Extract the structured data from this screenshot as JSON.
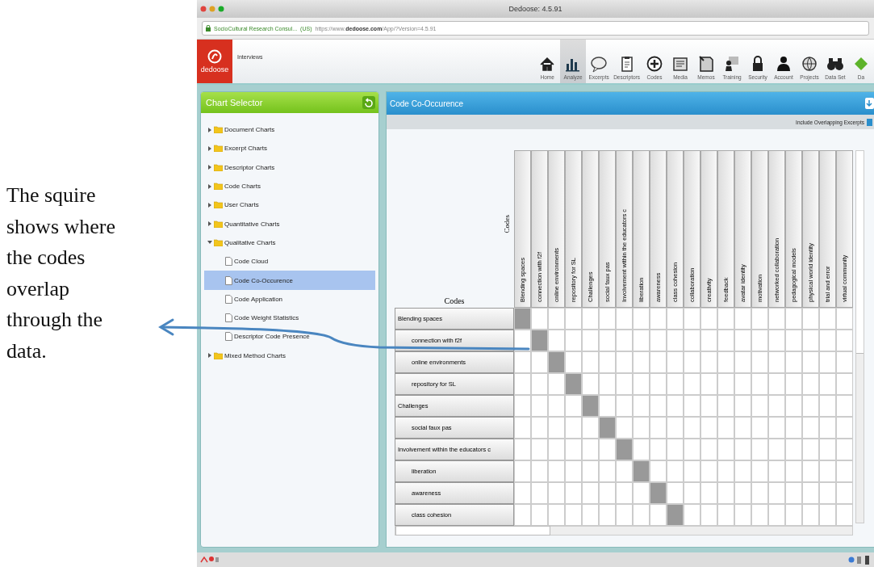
{
  "annotation": {
    "text": "The squire shows where the codes overlap through the data."
  },
  "window": {
    "title": "Dedoose: 4.5.91"
  },
  "address_bar": {
    "site": "SocioCultural Research Consul...",
    "country": "(US)",
    "url_start": "https://www.",
    "url_domain": "dedoose.com",
    "url_end": "/App/?Version=4.5.91"
  },
  "app_header": {
    "logo": "dedoose",
    "project": "Interviews"
  },
  "toolbar": [
    {
      "label": "Home",
      "selected": false
    },
    {
      "label": "Analyze",
      "selected": true
    },
    {
      "label": "Excerpts",
      "selected": false
    },
    {
      "label": "Descriptors",
      "selected": false
    },
    {
      "label": "Codes",
      "selected": false
    },
    {
      "label": "Media",
      "selected": false
    },
    {
      "label": "Memos",
      "selected": false
    },
    {
      "label": "Training",
      "selected": false
    },
    {
      "label": "Security",
      "selected": false
    },
    {
      "label": "Account",
      "selected": false
    },
    {
      "label": "Projects",
      "selected": false
    },
    {
      "label": "Data Set",
      "selected": false
    },
    {
      "label": "Da",
      "selected": false
    }
  ],
  "chart_selector": {
    "title": "Chart Selector",
    "tree": [
      {
        "label": "Document Charts",
        "kind": "folder",
        "expanded": false,
        "selected": false
      },
      {
        "label": "Excerpt Charts",
        "kind": "folder",
        "expanded": false,
        "selected": false
      },
      {
        "label": "Descriptor Charts",
        "kind": "folder",
        "expanded": false,
        "selected": false
      },
      {
        "label": "Code Charts",
        "kind": "folder",
        "expanded": false,
        "selected": false
      },
      {
        "label": "User Charts",
        "kind": "folder",
        "expanded": false,
        "selected": false
      },
      {
        "label": "Quantitative Charts",
        "kind": "folder",
        "expanded": false,
        "selected": false
      },
      {
        "label": "Qualitative Charts",
        "kind": "folder",
        "expanded": true,
        "selected": false,
        "children": [
          {
            "label": "Code Cloud",
            "kind": "chart",
            "selected": false
          },
          {
            "label": "Code Co-Occurence",
            "kind": "chart",
            "selected": true
          },
          {
            "label": "Code Application",
            "kind": "chart",
            "selected": false
          },
          {
            "label": "Code Weight Statistics",
            "kind": "chart",
            "selected": false
          },
          {
            "label": "Descriptor Code Presence",
            "kind": "chart",
            "selected": false
          }
        ]
      },
      {
        "label": "Mixed Method Charts",
        "kind": "folder",
        "expanded": false,
        "selected": false
      }
    ]
  },
  "co_occurrence": {
    "title": "Code Co-Occurence",
    "option": {
      "label": "Include Overlapping Excerpts",
      "checked": true
    },
    "column_axis_label": "Codes",
    "row_axis_label": "Codes",
    "columns": [
      "Blending spaces",
      "connection with f2f",
      "online environments",
      "repository for SL",
      "Challenges",
      "social faux pas",
      "Involvement within the educators c",
      "liberation",
      "awareness",
      "class cohesion",
      "collaboration",
      "creativity",
      "feedback",
      "avatar identity",
      "motivation",
      "networked collaboration",
      "pedagogical models",
      "physical world identity",
      "trial and error",
      "virtual community"
    ],
    "rows": [
      {
        "label": "Blending spaces",
        "shaded": [
          true,
          false,
          false,
          false,
          false,
          false,
          false,
          false,
          false,
          false,
          false,
          false,
          false,
          false,
          false,
          false,
          false,
          false,
          false,
          false
        ],
        "children": [
          {
            "label": "connection with f2f",
            "shaded": [
              false,
              true,
              false,
              false,
              false,
              false,
              false,
              false,
              false,
              false,
              false,
              false,
              false,
              false,
              false,
              false,
              false,
              false,
              false,
              false
            ]
          },
          {
            "label": "online environments",
            "shaded": [
              false,
              false,
              true,
              false,
              false,
              false,
              false,
              false,
              false,
              false,
              false,
              false,
              false,
              false,
              false,
              false,
              false,
              false,
              false,
              false
            ]
          },
          {
            "label": "repository for SL",
            "shaded": [
              false,
              false,
              false,
              true,
              false,
              false,
              false,
              false,
              false,
              false,
              false,
              false,
              false,
              false,
              false,
              false,
              false,
              false,
              false,
              false
            ]
          }
        ]
      },
      {
        "label": "Challenges",
        "shaded": [
          false,
          false,
          false,
          false,
          true,
          false,
          false,
          false,
          false,
          false,
          false,
          false,
          false,
          false,
          false,
          false,
          false,
          false,
          false,
          false
        ],
        "children": [
          {
            "label": "social faux pas",
            "shaded": [
              false,
              false,
              false,
              false,
              false,
              true,
              false,
              false,
              false,
              false,
              false,
              false,
              false,
              false,
              false,
              false,
              false,
              false,
              false,
              false
            ]
          }
        ]
      },
      {
        "label": "Involvement within the educators c",
        "shaded": [
          false,
          false,
          false,
          false,
          false,
          false,
          true,
          false,
          false,
          false,
          false,
          false,
          false,
          false,
          false,
          false,
          false,
          false,
          false,
          false
        ],
        "children": [
          {
            "label": "liberation",
            "shaded": [
              false,
              false,
              false,
              false,
              false,
              false,
              false,
              true,
              false,
              false,
              false,
              false,
              false,
              false,
              false,
              false,
              false,
              false,
              false,
              false
            ]
          },
          {
            "label": "awareness",
            "shaded": [
              false,
              false,
              false,
              false,
              false,
              false,
              false,
              false,
              true,
              false,
              false,
              false,
              false,
              false,
              false,
              false,
              false,
              false,
              false,
              false
            ]
          },
          {
            "label": "class cohesion",
            "shaded": [
              false,
              false,
              false,
              false,
              false,
              false,
              false,
              false,
              false,
              true,
              false,
              false,
              false,
              false,
              false,
              false,
              false,
              false,
              false,
              false
            ]
          }
        ]
      }
    ]
  }
}
